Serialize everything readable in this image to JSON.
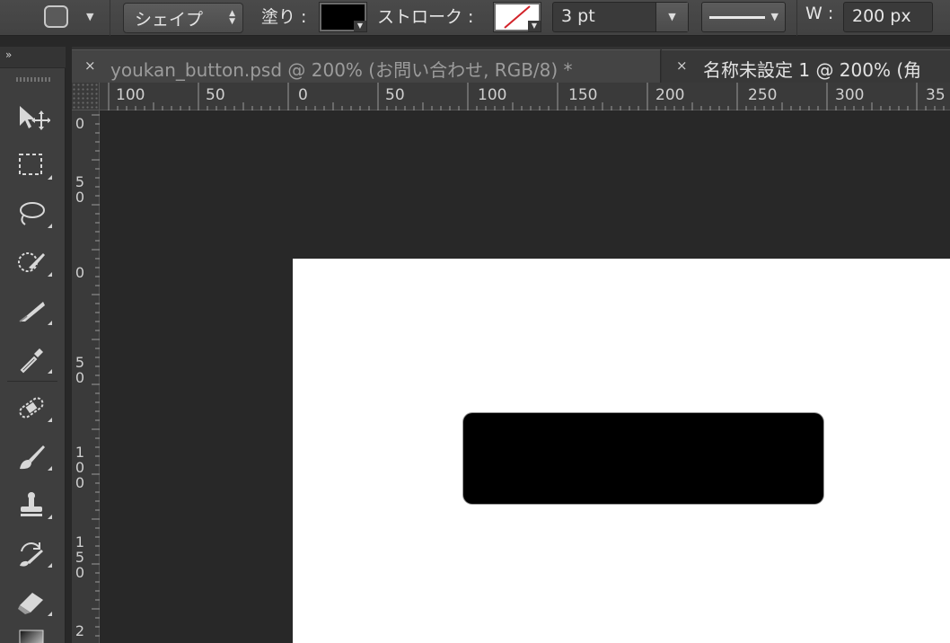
{
  "options_bar": {
    "tool_preset_caret": "▼",
    "mode_select": "シェイプ",
    "fill_label": "塗り :",
    "fill_color": "#000000",
    "stroke_label": "ストローク :",
    "stroke_color": "none",
    "stroke_width": "3 pt",
    "width_label": "W :",
    "width_value": "200 px"
  },
  "tabs": [
    {
      "close": "×",
      "title": "youkan_button.psd @ 200% (お問い合わせ, RGB/8) *",
      "active": true
    },
    {
      "close": "×",
      "title": "名称未設定 1 @ 200% (角",
      "active": false
    }
  ],
  "toolbar": {
    "collapse": "»",
    "tools": [
      {
        "name": "move-tool",
        "icon": "move-icon"
      },
      {
        "name": "rectangular-marquee-tool",
        "icon": "marquee-icon"
      },
      {
        "name": "lasso-tool",
        "icon": "lasso-icon"
      },
      {
        "name": "quick-selection-tool",
        "icon": "quick-selection-icon"
      },
      {
        "name": "crop-tool",
        "icon": "crop-icon"
      },
      {
        "name": "eyedropper-tool",
        "icon": "eyedropper-icon"
      },
      {
        "name": "spot-healing-tool",
        "icon": "bandage-icon"
      },
      {
        "name": "brush-tool",
        "icon": "brush-icon"
      },
      {
        "name": "clone-stamp-tool",
        "icon": "stamp-icon"
      },
      {
        "name": "history-brush-tool",
        "icon": "history-brush-icon"
      },
      {
        "name": "eraser-tool",
        "icon": "eraser-icon"
      },
      {
        "name": "gradient-tool",
        "icon": "gradient-icon"
      }
    ]
  },
  "ruler_h": [
    "100",
    "50",
    "0",
    "50",
    "100",
    "150",
    "200",
    "250",
    "300",
    "35"
  ],
  "ruler_v": [
    "0",
    "50",
    "0",
    "50",
    "100",
    "150",
    "2"
  ],
  "colors": {
    "ui_background": "#282828",
    "document_background": "#ffffff",
    "shape_fill": "#000000"
  }
}
